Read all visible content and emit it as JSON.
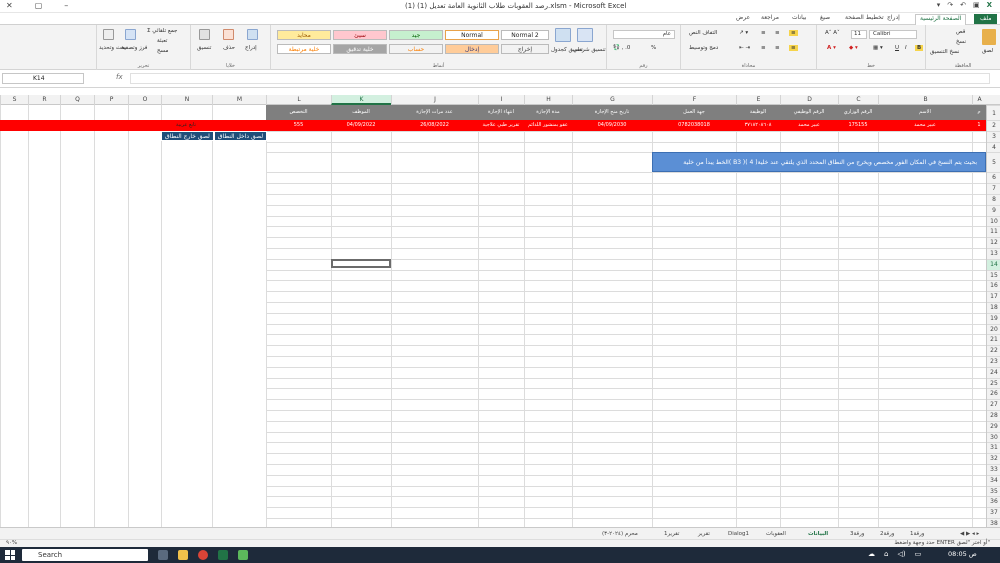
{
  "window": {
    "title": "رصد العقوبات طلاب الثانوية العامة تعديل (1) (1).xlsm - Microsoft Excel",
    "controls": [
      "✕",
      "▢",
      "–"
    ]
  },
  "ribbon_tabs": {
    "file": "ملف",
    "home": "الصفحة الرئيسية",
    "insert": "إدراج",
    "page_layout": "تخطيط الصفحة",
    "formulas": "صيغ",
    "data": "بيانات",
    "review": "مراجعة",
    "view": "عرض"
  },
  "ribbon": {
    "clipboard": {
      "paste": "لصق",
      "cut": "قص",
      "copy": "نسخ",
      "format_painter": "نسخ التنسيق",
      "group": "الحافظة"
    },
    "font": {
      "name": "Calibri",
      "size": "11",
      "bold": "B",
      "italic": "I",
      "underline": "U",
      "group": "خط"
    },
    "alignment": {
      "wrap": "التفاف النص",
      "merge": "دمج وتوسيط",
      "group": "محاذاة"
    },
    "number": {
      "format": "عام",
      "percent": "%",
      "group": "رقم"
    },
    "styles": {
      "conditional": "تنسيق شرطي",
      "table": "تنسيق كجدول",
      "normal2": "Normal 2",
      "normal": "Normal",
      "good": "جيد",
      "bad": "سيئ",
      "neutral": "محايد",
      "output": "إخراج",
      "input": "إدخال",
      "calc": "حساب",
      "check": "خلية تدقيق",
      "linked": "خلية مرتبطة",
      "group": "أنماط"
    },
    "cells": {
      "insert": "إدراج",
      "delete": "حذف",
      "format": "تنسيق",
      "group": "خلايا"
    },
    "editing": {
      "autosum": "جمع تلقائي",
      "fill": "تعبئة",
      "clear": "مسح",
      "sort": "فرز وتصفية",
      "find": "بحث وتحديد",
      "group": "تحرير"
    }
  },
  "formula_bar": {
    "name_box": "K14",
    "fx": "fx",
    "content": ""
  },
  "columns": [
    "A",
    "B",
    "C",
    "D",
    "E",
    "F",
    "G",
    "H",
    "I",
    "J",
    "K",
    "L",
    "M",
    "N",
    "O",
    "P",
    "Q",
    "R",
    "S"
  ],
  "selected_column": "K",
  "selected_row": "14",
  "row_numbers": [
    "1",
    "2",
    "3",
    "4",
    "5",
    "6",
    "7",
    "8",
    "9",
    "10",
    "11",
    "12",
    "13",
    "14",
    "15",
    "16",
    "17",
    "18",
    "19",
    "20",
    "21",
    "22",
    "23",
    "24",
    "25",
    "26",
    "27",
    "28",
    "29",
    "30",
    "31",
    "32",
    "33",
    "34",
    "35",
    "36",
    "37",
    "38",
    "39"
  ],
  "header_row": {
    "A": "م",
    "B": "الاسم",
    "C": "الرقم الوزاري",
    "D": "الرقم الوظيفي",
    "E": "الوظيفة",
    "F": "جهة العمل",
    "G": "تاريخ منح الإجازة",
    "H": "مدة الإجازة",
    "I": "انتهاء الإجازة",
    "J": "عدد مرات الإجازة",
    "K": "الموظف",
    "L": "التخصص"
  },
  "data_row": {
    "A": "1",
    "B": "عبير محمد",
    "C": "175155",
    "D": "عبير محمد",
    "E": "٣٧١٨٢٠٨٦٠٨",
    "F": "0782038018",
    "G": "04/09/2030",
    "H": "عقو بمنشور اللدائم",
    "I": "تقرير طبي علاجية",
    "J": "26/08/2022",
    "K": "04/09/2022",
    "L": "555",
    "N": "تابع عربية"
  },
  "note_text": "الخط يبدأ من خلية( B3 )بحيث يتم النسخ في المكان الفور مخصص ويخرج من النطاق المحدد الذي يلتقي عند خلية( 4 )",
  "paste_buttons": {
    "inside": "لصق داخل النطاق",
    "outside": "لصق خارج النطاق"
  },
  "sheet_tabs": [
    "ورقة1",
    "ورقة2",
    "ورقة3",
    "البيانات",
    "العقوبات",
    "Dialog1",
    "تقرير",
    "تقرير1",
    "محرم (٢٠٢٤-٣)"
  ],
  "active_sheet": "البيانات",
  "status": {
    "text": "حدد وجهة واضغط ENTER أو اختر \"لصق\"",
    "zoom": "٩٠%"
  },
  "taskbar": {
    "search": "Search",
    "time": "08:05",
    "date": "ص"
  }
}
